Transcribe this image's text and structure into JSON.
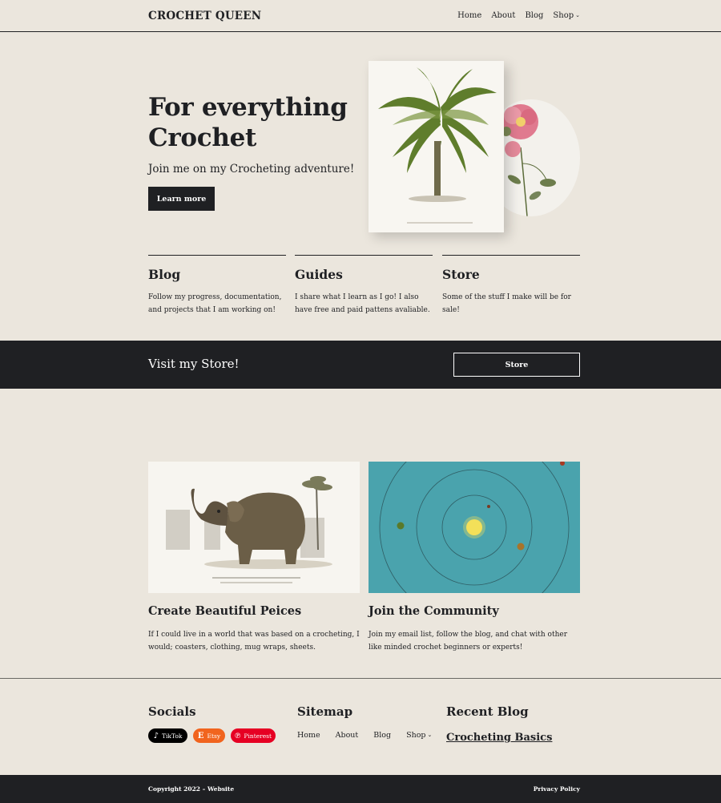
{
  "header": {
    "site_title": "CROCHET QUEEN",
    "nav": [
      "Home",
      "About",
      "Blog",
      "Shop"
    ]
  },
  "hero": {
    "title": "For everything Crochet",
    "subtitle": "Join me on my Crocheting adventure!",
    "cta_label": "Learn more"
  },
  "features": [
    {
      "title": "Blog",
      "text": "Follow my progress, documentation, and projects that I am working on!"
    },
    {
      "title": "Guides",
      "text": "I share what I learn as I go! I also have free and paid pattens avaliable."
    },
    {
      "title": "Store",
      "text": "Some of the stuff I make will be for sale!"
    }
  ],
  "store_band": {
    "title": "Visit my Store!",
    "button_label": "Store"
  },
  "cards": [
    {
      "title": "Create Beautiful Peices",
      "text": "If I could live in a world that was based on a crocheting, I would; coasters, clothing, mug wraps, sheets."
    },
    {
      "title": "Join the Community",
      "text": "Join my email list, follow the blog, and chat with other like minded crochet beginners or experts!"
    }
  ],
  "footer": {
    "socials_heading": "Socials",
    "socials": [
      {
        "label": "TikTok",
        "icon": "tiktok-icon",
        "color": "#000000"
      },
      {
        "label": "Etsy",
        "icon": "etsy-icon",
        "color": "#f1641e"
      },
      {
        "label": "Pinterest",
        "icon": "pinterest-icon",
        "color": "#e60023"
      }
    ],
    "sitemap_heading": "Sitemap",
    "sitemap": [
      "Home",
      "About",
      "Blog",
      "Shop"
    ],
    "recent_heading": "Recent Blog",
    "recent_post": "Crocheting Basics",
    "copyright": "Copyright 2022 – Website",
    "privacy": "Privacy Policy"
  },
  "colors": {
    "background": "#ebe6dd",
    "dark": "#1f2023",
    "ocean": "#4aa3ad"
  }
}
